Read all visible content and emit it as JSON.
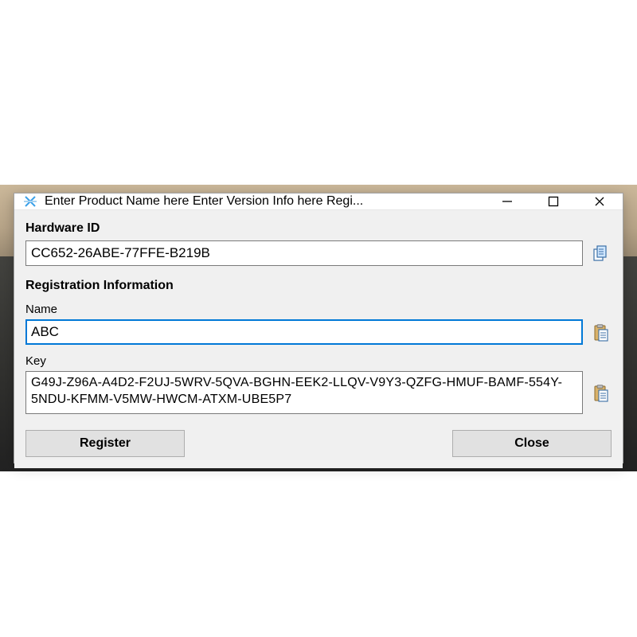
{
  "window": {
    "title": "Enter Product Name here Enter Version Info here Regi..."
  },
  "hardware": {
    "heading": "Hardware ID",
    "value": "CC652-26ABE-77FFE-B219B"
  },
  "registration": {
    "heading": "Registration Information",
    "name_label": "Name",
    "name_value": "ABC",
    "key_label": "Key",
    "key_value": "G49J-Z96A-A4D2-F2UJ-5WRV-5QVA-BGHN-EEK2-LLQV-V9Y3-QZFG-HMUF-BAMF-554Y-5NDU-KFMM-V5MW-HWCM-ATXM-UBE5P7"
  },
  "buttons": {
    "register": "Register",
    "close": "Close"
  }
}
